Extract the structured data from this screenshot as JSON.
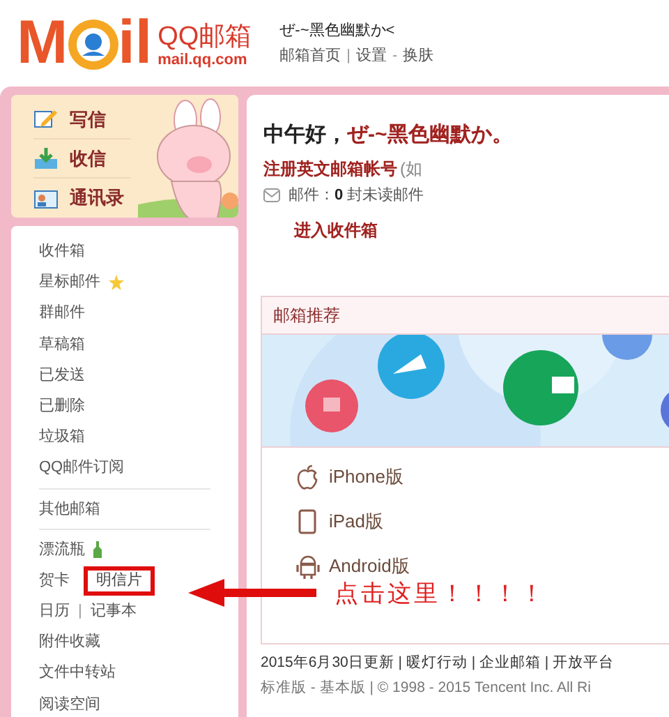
{
  "header": {
    "logo": {
      "left": "M",
      "right": "il",
      "name": "QQ邮箱",
      "domain": "mail.qq.com"
    },
    "username": "ぜ-~黑色幽默か<",
    "nav": [
      {
        "kind": "link",
        "label": "邮箱首页"
      },
      {
        "kind": "sep",
        "label": "|"
      },
      {
        "kind": "link",
        "label": "设置"
      },
      {
        "kind": "sep",
        "label": "-"
      },
      {
        "kind": "link",
        "label": "换肤"
      }
    ]
  },
  "sidebar": {
    "actions": [
      {
        "kind": "compose",
        "label": "写信"
      },
      {
        "kind": "receive",
        "label": "收信"
      },
      {
        "kind": "contacts",
        "label": "通讯录"
      }
    ],
    "groups": [
      [
        {
          "kind": "plain",
          "items": [
            {
              "label": "收件箱",
              "highlighted": false
            }
          ]
        },
        {
          "kind": "starred",
          "items": [
            {
              "label": "星标邮件",
              "highlighted": false
            }
          ]
        },
        {
          "kind": "plain",
          "items": [
            {
              "label": "群邮件",
              "highlighted": false
            }
          ]
        },
        {
          "kind": "plain",
          "items": [
            {
              "label": "草稿箱",
              "highlighted": false
            }
          ]
        },
        {
          "kind": "plain",
          "items": [
            {
              "label": "已发送",
              "highlighted": false
            }
          ]
        },
        {
          "kind": "plain",
          "items": [
            {
              "label": "已删除",
              "highlighted": false
            }
          ]
        },
        {
          "kind": "plain",
          "items": [
            {
              "label": "垃圾箱",
              "highlighted": false
            }
          ]
        },
        {
          "kind": "plain",
          "items": [
            {
              "label": "QQ邮件订阅",
              "highlighted": false
            }
          ]
        }
      ],
      [
        {
          "kind": "plain",
          "items": [
            {
              "label": "其他邮箱",
              "highlighted": false
            }
          ]
        }
      ],
      [
        {
          "kind": "bottle",
          "items": [
            {
              "label": "漂流瓶",
              "highlighted": false
            }
          ]
        },
        {
          "kind": "plain",
          "items": [
            {
              "label": "贺卡",
              "highlighted": false
            },
            {
              "label": "明信片",
              "highlighted": true
            }
          ]
        },
        {
          "kind": "plain",
          "items": [
            {
              "label": "日历",
              "highlighted": false
            },
            {
              "label": "记事本",
              "highlighted": false
            }
          ],
          "separator": "|"
        },
        {
          "kind": "plain",
          "items": [
            {
              "label": "附件收藏",
              "highlighted": false
            }
          ]
        },
        {
          "kind": "plain",
          "items": [
            {
              "label": "文件中转站",
              "highlighted": false
            }
          ]
        },
        {
          "kind": "plain",
          "items": [
            {
              "label": "阅读空间",
              "highlighted": false
            }
          ]
        }
      ]
    ]
  },
  "callout": {
    "label": "点击这里！！！！"
  },
  "main": {
    "greeting": "中午好，",
    "greeting_name": "ぜ-~黑色幽默か。",
    "register_link": "注册英文邮箱帐号",
    "register_note": "(如",
    "mail_status": {
      "prefix": "邮件：",
      "count": "0",
      "suffix": " 封未读邮件"
    },
    "inbox_link": "进入收件箱",
    "recommend": {
      "title": "邮箱推荐",
      "apps": [
        {
          "kind": "apple",
          "label": "iPhone版"
        },
        {
          "kind": "tablet",
          "label": "iPad版"
        },
        {
          "kind": "android",
          "label": "Android版"
        }
      ]
    },
    "footer": [
      "2015年6月30日更新 | 暖灯行动 | 企业邮箱 | 开放平台",
      "标准版 - 基本版 | © 1998 - 2015 Tencent Inc. All Ri"
    ]
  }
}
